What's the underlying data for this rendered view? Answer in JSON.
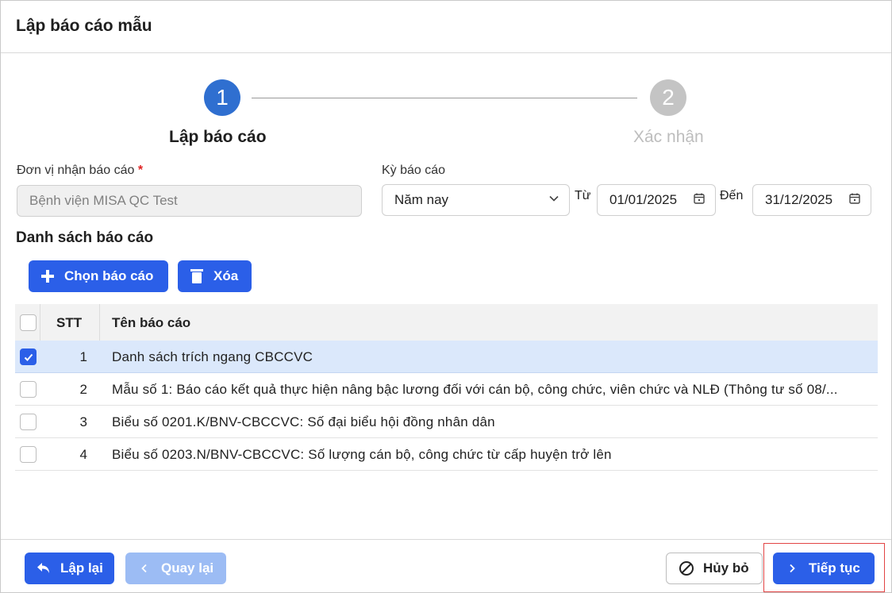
{
  "dialog": {
    "title": "Lập báo cáo mẫu"
  },
  "stepper": {
    "steps": [
      {
        "number": "1",
        "label": "Lập báo cáo",
        "state": "active"
      },
      {
        "number": "2",
        "label": "Xác nhận",
        "state": "inactive"
      }
    ]
  },
  "form": {
    "unit_label": "Đơn vị nhận báo cáo",
    "required_mark": "*",
    "unit_placeholder": "Bệnh viện MISA QC Test",
    "period_label": "Kỳ báo cáo",
    "period_value": "Năm nay",
    "from_label": "Từ",
    "from_date": "01/01/2025",
    "to_label": "Đến",
    "to_date": "31/12/2025"
  },
  "report_list": {
    "title": "Danh sách báo cáo",
    "choose_button": "Chọn báo cáo",
    "delete_button": "Xóa",
    "columns": {
      "stt": "STT",
      "name": "Tên báo cáo"
    },
    "rows": [
      {
        "stt": "1",
        "name": "Danh sách trích ngang CBCCVC",
        "checked": true
      },
      {
        "stt": "2",
        "name": "Mẫu số 1: Báo cáo kết quả thực hiện nâng bậc lương đối với cán bộ, công chức, viên chức và NLĐ (Thông tư số 08/...",
        "checked": false
      },
      {
        "stt": "3",
        "name": "Biểu số 0201.K/BNV-CBCCVC: Số đại biểu hội đồng nhân dân",
        "checked": false
      },
      {
        "stt": "4",
        "name": "Biểu số 0203.N/BNV-CBCCVC: Số lượng cán bộ, công chức từ cấp huyện trở lên",
        "checked": false
      }
    ]
  },
  "footer": {
    "reset_button": "Lập lại",
    "back_button": "Quay lại",
    "cancel_button": "Hủy bỏ",
    "next_button": "Tiếp tục"
  },
  "colors": {
    "primary": "#2b5fe8",
    "step_active": "#2f6fd0",
    "step_inactive": "#c4c4c4",
    "selected_row": "#dbe8fb",
    "highlight": "#e24444"
  }
}
